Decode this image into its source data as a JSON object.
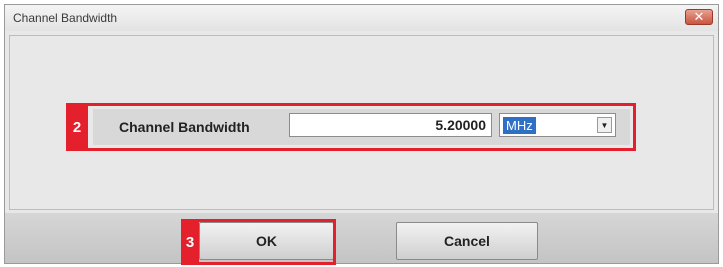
{
  "window": {
    "title": "Channel Bandwidth",
    "close_glyph": "✕"
  },
  "field": {
    "label": "Channel Bandwidth",
    "value": "5.20000",
    "unit": "MHz",
    "dropdown_glyph": "▼"
  },
  "buttons": {
    "ok_label": "OK",
    "cancel_label": "Cancel"
  },
  "annotations": {
    "step2": "2",
    "step3": "3"
  },
  "colors": {
    "annotation_red": "#e4202c",
    "selection_blue": "#2f6fc6"
  }
}
